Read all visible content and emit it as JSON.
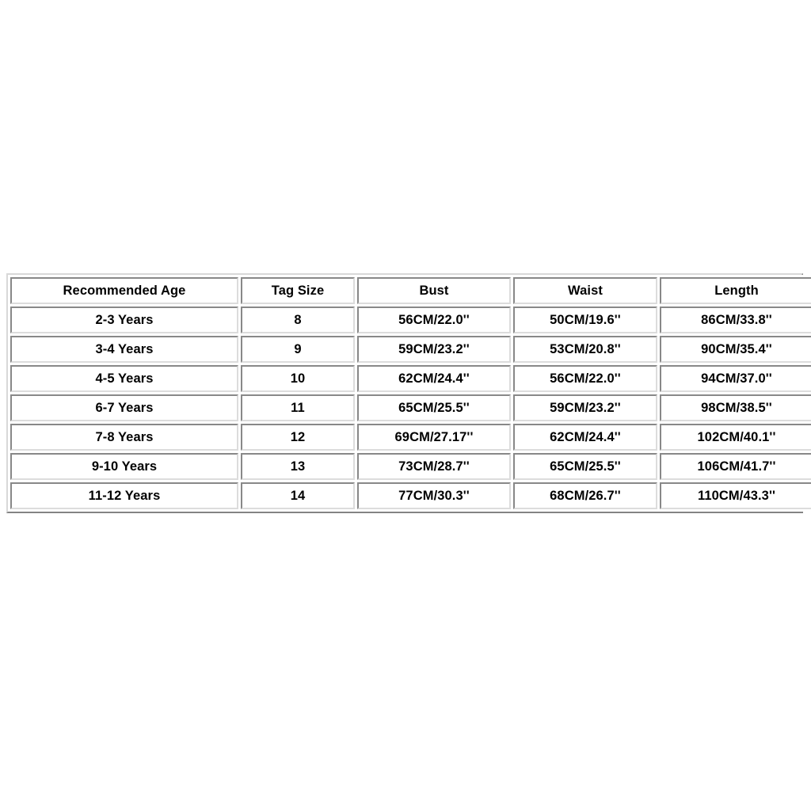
{
  "page": {
    "background_color": "#ffffff",
    "text_color": "#000000",
    "border_color": "#dcdcdc"
  },
  "size_chart": {
    "columns": [
      "Recommended Age",
      "Tag Size",
      "Bust",
      "Waist",
      "Length"
    ],
    "rows": [
      {
        "recommended_age": "2-3 Years",
        "tag_size": "8",
        "bust": "56CM/22.0''",
        "waist": "50CM/19.6''",
        "length": "86CM/33.8''"
      },
      {
        "recommended_age": "3-4 Years",
        "tag_size": "9",
        "bust": "59CM/23.2''",
        "waist": "53CM/20.8''",
        "length": "90CM/35.4''"
      },
      {
        "recommended_age": "4-5 Years",
        "tag_size": "10",
        "bust": "62CM/24.4''",
        "waist": "56CM/22.0''",
        "length": "94CM/37.0''"
      },
      {
        "recommended_age": "6-7 Years",
        "tag_size": "11",
        "bust": "65CM/25.5''",
        "waist": "59CM/23.2''",
        "length": "98CM/38.5''"
      },
      {
        "recommended_age": "7-8 Years",
        "tag_size": "12",
        "bust": "69CM/27.17''",
        "waist": "62CM/24.4''",
        "length": "102CM/40.1''"
      },
      {
        "recommended_age": "9-10 Years",
        "tag_size": "13",
        "bust": "73CM/28.7''",
        "waist": "65CM/25.5''",
        "length": "106CM/41.7''"
      },
      {
        "recommended_age": "11-12 Years",
        "tag_size": "14",
        "bust": "77CM/30.3''",
        "waist": "68CM/26.7''",
        "length": "110CM/43.3''"
      }
    ]
  }
}
